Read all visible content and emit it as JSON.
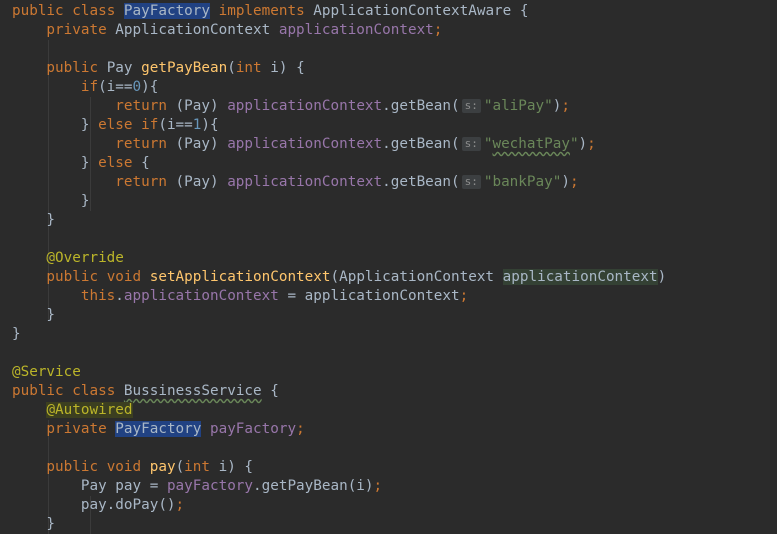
{
  "lines": [
    {
      "tokens": [
        {
          "t": "public ",
          "c": "kw"
        },
        {
          "t": "class ",
          "c": "kw"
        },
        {
          "t": "PayFactory",
          "c": "sel"
        },
        {
          "t": " implements ",
          "c": "kw"
        },
        {
          "t": "ApplicationContextAware {",
          "c": "op"
        }
      ]
    },
    {
      "tokens": [
        {
          "t": "    private ",
          "c": "kw"
        },
        {
          "t": "ApplicationContext ",
          "c": "op"
        },
        {
          "t": "applicationContext",
          "c": "fld"
        },
        {
          "t": ";",
          "c": "kw"
        }
      ]
    },
    {
      "tokens": []
    },
    {
      "tokens": [
        {
          "t": "    public ",
          "c": "kw"
        },
        {
          "t": "Pay ",
          "c": "op"
        },
        {
          "t": "getPayBean",
          "c": "fn"
        },
        {
          "t": "(",
          "c": "op"
        },
        {
          "t": "int ",
          "c": "kw"
        },
        {
          "t": "i) {",
          "c": "op"
        }
      ]
    },
    {
      "tokens": [
        {
          "t": "        if",
          "c": "kw"
        },
        {
          "t": "(i==",
          "c": "op"
        },
        {
          "t": "0",
          "c": "num"
        },
        {
          "t": "){",
          "c": "op"
        }
      ]
    },
    {
      "tokens": [
        {
          "t": "            return ",
          "c": "kw"
        },
        {
          "t": "(Pay) ",
          "c": "op"
        },
        {
          "t": "applicationContext",
          "c": "fld"
        },
        {
          "t": ".getBean(",
          "c": "op"
        },
        {
          "t": "s:",
          "c": "hint"
        },
        {
          "t": "\"aliPay\"",
          "c": "str"
        },
        {
          "t": ")",
          "c": "op"
        },
        {
          "t": ";",
          "c": "kw"
        }
      ]
    },
    {
      "tokens": [
        {
          "t": "        } ",
          "c": "op"
        },
        {
          "t": "else if",
          "c": "kw"
        },
        {
          "t": "(i==",
          "c": "op"
        },
        {
          "t": "1",
          "c": "num"
        },
        {
          "t": "){",
          "c": "op"
        }
      ]
    },
    {
      "tokens": [
        {
          "t": "            return ",
          "c": "kw"
        },
        {
          "t": "(Pay) ",
          "c": "op"
        },
        {
          "t": "applicationContext",
          "c": "fld"
        },
        {
          "t": ".getBean(",
          "c": "op"
        },
        {
          "t": "s:",
          "c": "hint"
        },
        {
          "t": "\"",
          "c": "str"
        },
        {
          "t": "wechatPay",
          "c": "str squiggle"
        },
        {
          "t": "\"",
          "c": "str"
        },
        {
          "t": ")",
          "c": "op"
        },
        {
          "t": ";",
          "c": "kw"
        }
      ]
    },
    {
      "tokens": [
        {
          "t": "        } ",
          "c": "op"
        },
        {
          "t": "else ",
          "c": "kw"
        },
        {
          "t": "{",
          "c": "op"
        }
      ]
    },
    {
      "tokens": [
        {
          "t": "            return ",
          "c": "kw"
        },
        {
          "t": "(Pay) ",
          "c": "op"
        },
        {
          "t": "applicationContext",
          "c": "fld"
        },
        {
          "t": ".getBean(",
          "c": "op"
        },
        {
          "t": "s:",
          "c": "hint"
        },
        {
          "t": "\"bankPay\"",
          "c": "str"
        },
        {
          "t": ")",
          "c": "op"
        },
        {
          "t": ";",
          "c": "kw"
        }
      ]
    },
    {
      "tokens": [
        {
          "t": "        }",
          "c": "op"
        }
      ]
    },
    {
      "tokens": [
        {
          "t": "    }",
          "c": "op"
        }
      ]
    },
    {
      "tokens": []
    },
    {
      "tokens": [
        {
          "t": "    @Override",
          "c": "ann"
        }
      ]
    },
    {
      "tokens": [
        {
          "t": "    public ",
          "c": "kw"
        },
        {
          "t": "void ",
          "c": "kw"
        },
        {
          "t": "setApplicationContext",
          "c": "fn"
        },
        {
          "t": "(ApplicationContext ",
          "c": "op"
        },
        {
          "t": "applicationContext",
          "c": "op hlparam"
        },
        {
          "t": ")",
          "c": "op"
        }
      ]
    },
    {
      "tokens": [
        {
          "t": "        this",
          "c": "kw"
        },
        {
          "t": ".",
          "c": "op"
        },
        {
          "t": "applicationContext",
          "c": "fld"
        },
        {
          "t": " = applicationContext",
          "c": "op"
        },
        {
          "t": ";",
          "c": "kw"
        }
      ]
    },
    {
      "tokens": [
        {
          "t": "    }",
          "c": "op"
        }
      ]
    },
    {
      "tokens": [
        {
          "t": "}",
          "c": "op"
        }
      ]
    },
    {
      "tokens": []
    },
    {
      "tokens": [
        {
          "t": "@Service",
          "c": "ann"
        }
      ]
    },
    {
      "tokens": [
        {
          "t": "public ",
          "c": "kw"
        },
        {
          "t": "class ",
          "c": "kw"
        },
        {
          "t": "BussinessService",
          "c": "op squiggle"
        },
        {
          "t": " {",
          "c": "op"
        }
      ]
    },
    {
      "tokens": [
        {
          "t": "    ",
          "c": "op"
        },
        {
          "t": "@Autowired",
          "c": "ann hlann"
        }
      ]
    },
    {
      "tokens": [
        {
          "t": "    private ",
          "c": "kw"
        },
        {
          "t": "PayFactory",
          "c": "sel"
        },
        {
          "t": " ",
          "c": "op"
        },
        {
          "t": "payFactory",
          "c": "fld"
        },
        {
          "t": ";",
          "c": "kw"
        }
      ]
    },
    {
      "tokens": []
    },
    {
      "tokens": [
        {
          "t": "    public ",
          "c": "kw"
        },
        {
          "t": "void ",
          "c": "kw"
        },
        {
          "t": "pay",
          "c": "fn"
        },
        {
          "t": "(",
          "c": "op"
        },
        {
          "t": "int ",
          "c": "kw"
        },
        {
          "t": "i) {",
          "c": "op"
        }
      ]
    },
    {
      "tokens": [
        {
          "t": "        Pay pay = ",
          "c": "op"
        },
        {
          "t": "payFactory",
          "c": "fld"
        },
        {
          "t": ".getPayBean(i)",
          "c": "op"
        },
        {
          "t": ";",
          "c": "kw"
        }
      ]
    },
    {
      "tokens": [
        {
          "t": "        pay.doPay()",
          "c": "op"
        },
        {
          "t": ";",
          "c": "kw"
        }
      ]
    },
    {
      "tokens": [
        {
          "t": "    }",
          "c": "op"
        }
      ]
    }
  ]
}
